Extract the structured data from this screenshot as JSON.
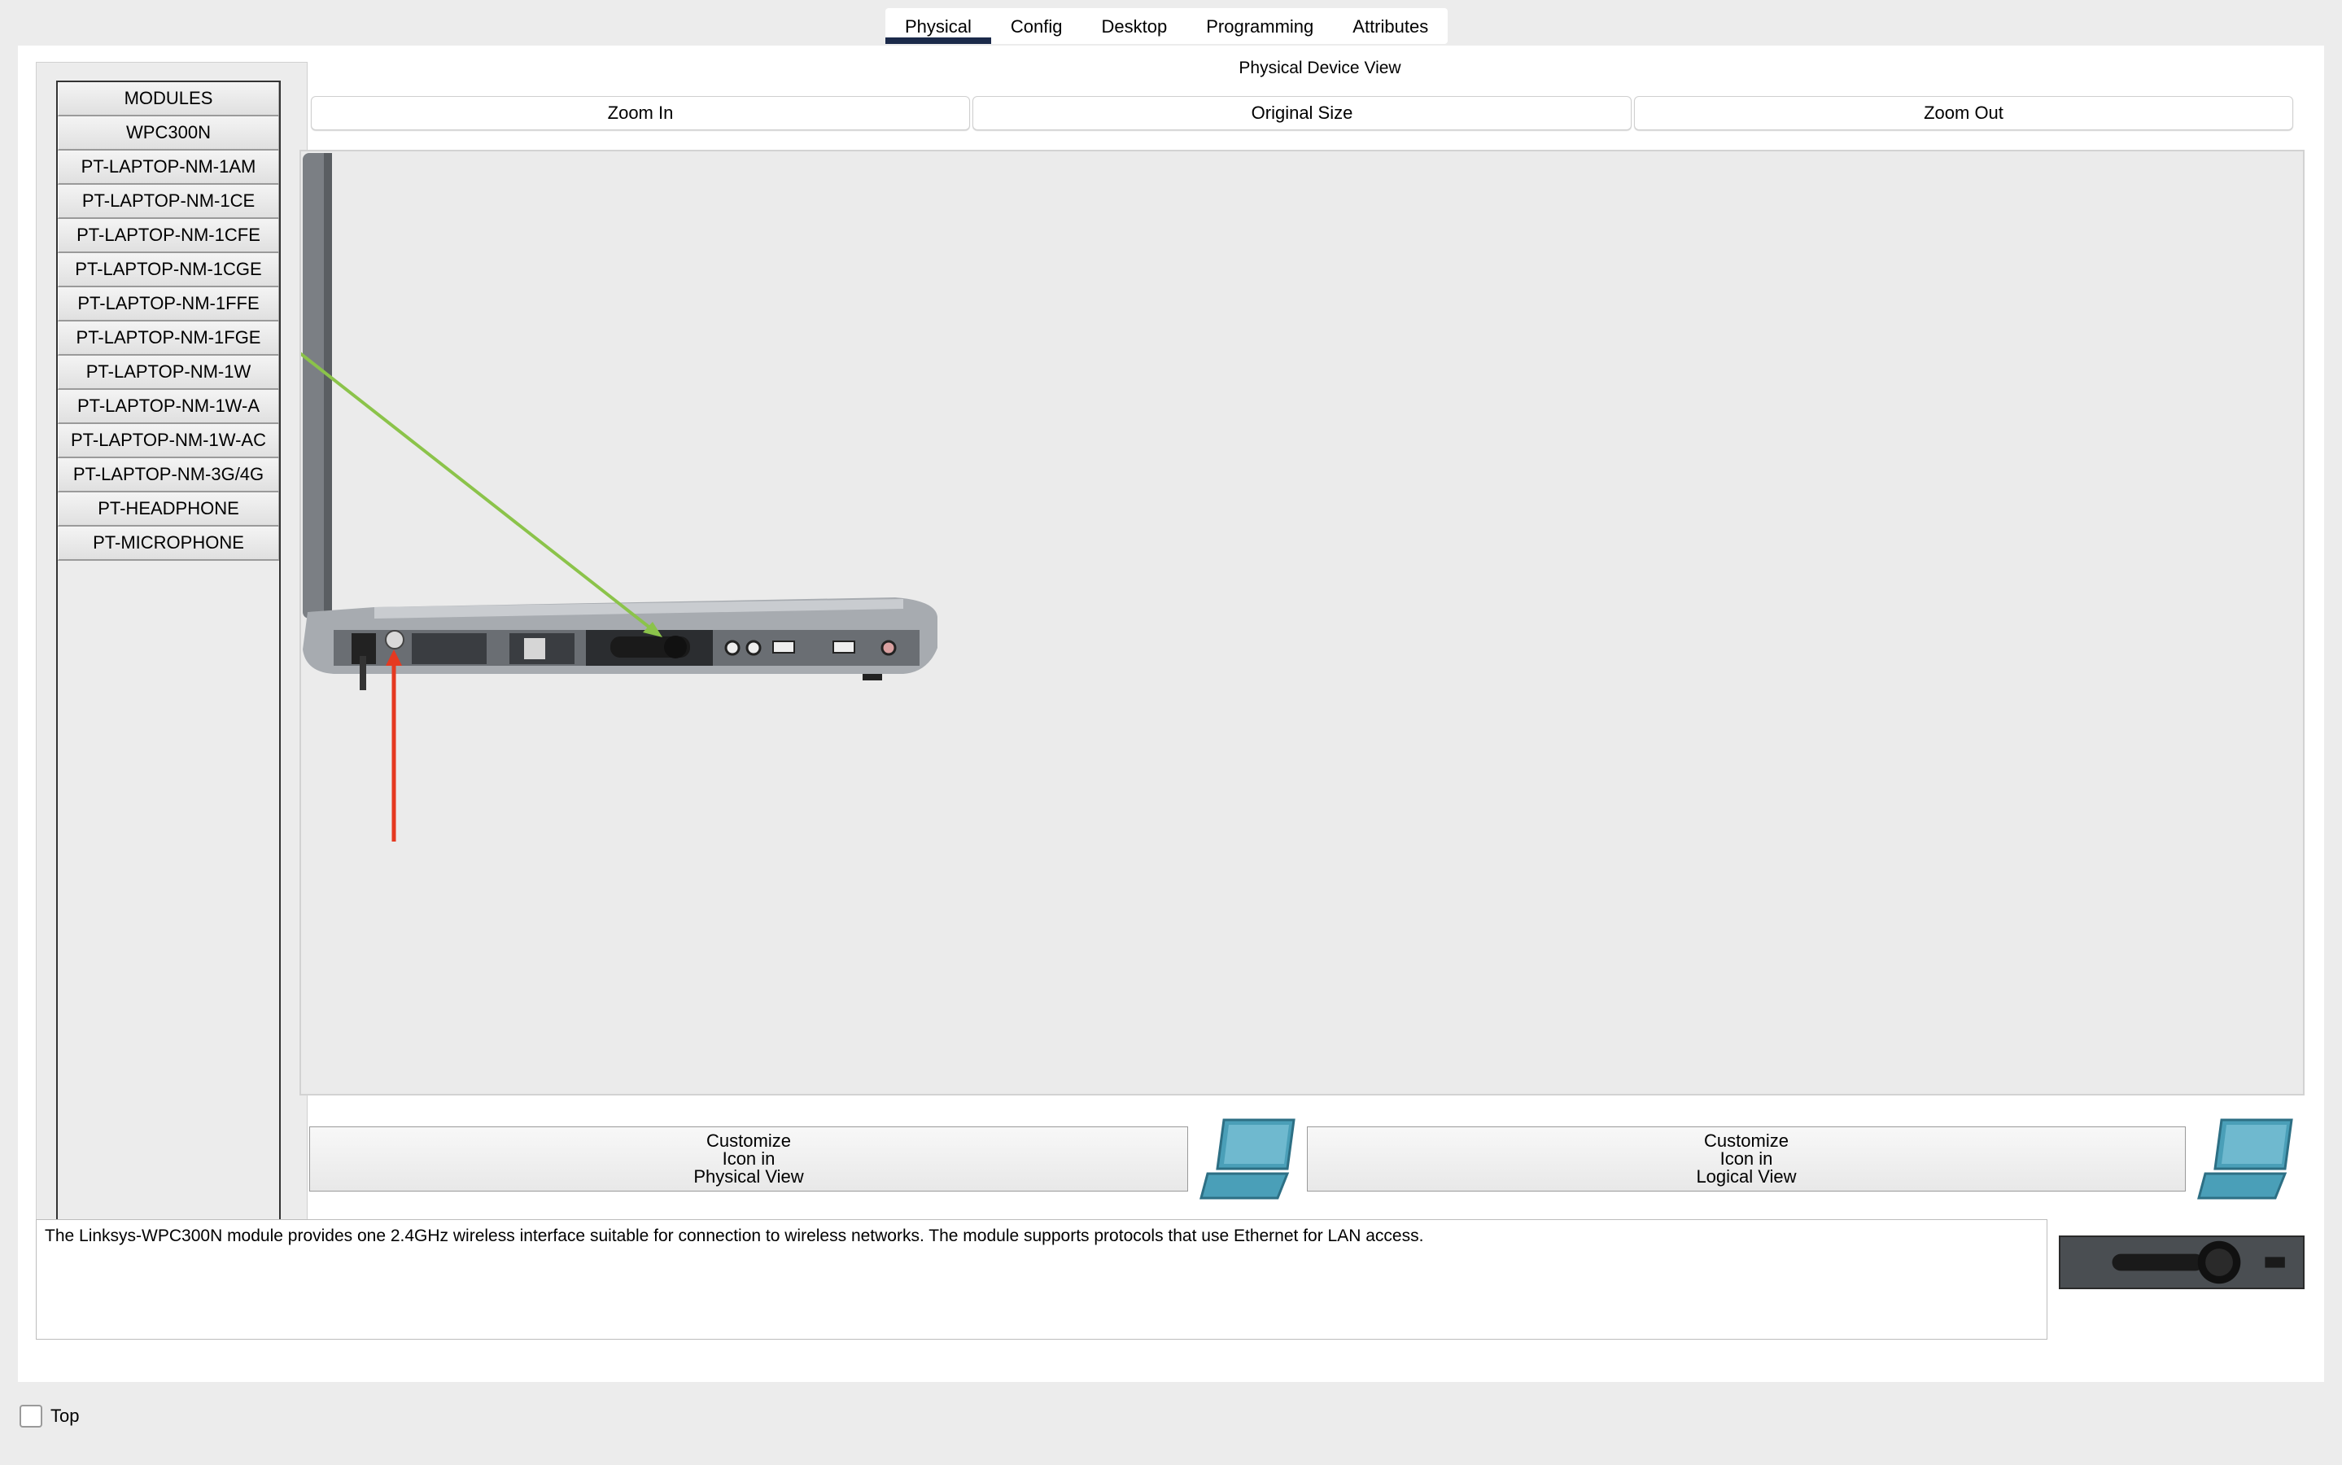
{
  "tabs": [
    {
      "label": "Physical",
      "active": true
    },
    {
      "label": "Config",
      "active": false
    },
    {
      "label": "Desktop",
      "active": false
    },
    {
      "label": "Programming",
      "active": false
    },
    {
      "label": "Attributes",
      "active": false
    }
  ],
  "modules": {
    "header": "MODULES",
    "items": [
      "WPC300N",
      "PT-LAPTOP-NM-1AM",
      "PT-LAPTOP-NM-1CE",
      "PT-LAPTOP-NM-1CFE",
      "PT-LAPTOP-NM-1CGE",
      "PT-LAPTOP-NM-1FFE",
      "PT-LAPTOP-NM-1FGE",
      "PT-LAPTOP-NM-1W",
      "PT-LAPTOP-NM-1W-A",
      "PT-LAPTOP-NM-1W-AC",
      "PT-LAPTOP-NM-3G/4G",
      "PT-HEADPHONE",
      "PT-MICROPHONE"
    ]
  },
  "view": {
    "title": "Physical Device View",
    "zoom_in": "Zoom In",
    "original_size": "Original Size",
    "zoom_out": "Zoom Out"
  },
  "customize": {
    "physical": {
      "line1": "Customize",
      "line2": "Icon in",
      "line3": "Physical View"
    },
    "logical": {
      "line1": "Customize",
      "line2": "Icon in",
      "line3": "Logical View"
    }
  },
  "description": "The Linksys-WPC300N module provides one 2.4GHz wireless interface suitable for connection to wireless networks. The module supports protocols that use Ethernet for LAN access.",
  "top_checkbox": {
    "label": "Top",
    "checked": false
  },
  "colors": {
    "active_tab_underline": "#1b2a4a",
    "annotation_green": "#8bc34a",
    "annotation_red": "#e53920",
    "laptop_icon": "#4a9fb8"
  },
  "icons": {
    "laptop": "laptop-icon",
    "wireless_card": "wireless-card-icon"
  }
}
